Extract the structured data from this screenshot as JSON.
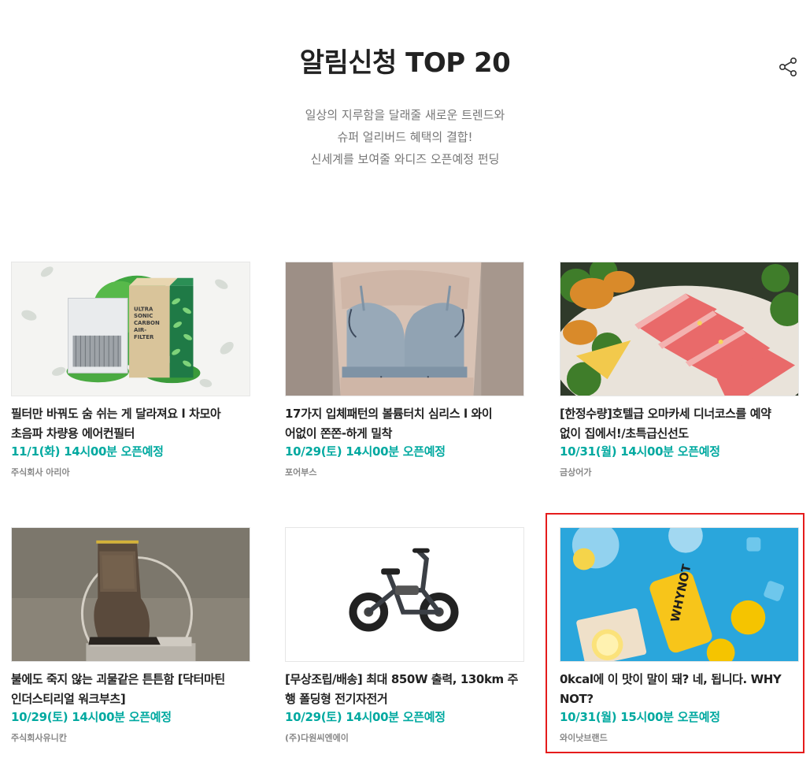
{
  "header": {
    "title": "알림신청 TOP 20",
    "subtitle_lines": [
      "일상의 지루함을 달래줄 새로운 트렌드와",
      "슈퍼 얼리버드 혜택의 결합!",
      "신세계를 보여줄 와디즈 오픈예정 펀딩"
    ],
    "share_icon": "share-icon"
  },
  "cards": [
    {
      "title_lines": [
        "필터만 바꿔도 숨 쉬는 게 달라져요 l 차모아",
        "초음파 차량용 에어컨필터"
      ],
      "open": "11/1(화) 14시00분 오픈예정",
      "maker": "주식회사 아리아",
      "image": "car-air-filter-product",
      "product_text": [
        "ULTRA",
        "SONIC",
        "CARBON",
        "AIR-",
        "FILTER"
      ]
    },
    {
      "title_lines": [
        "17가지 입체패턴의 볼륨터치 심리스 l 와이",
        "어없이 쫀쫀-하게 밀착"
      ],
      "open": "10/29(토) 14시00분 오픈예정",
      "maker": "포어부스",
      "image": "seamless-bra"
    },
    {
      "title_lines": [
        "[한정수량]호텔급 오마카세 디너코스를 예약",
        "없이 집에서!/초특급신선도"
      ],
      "open": "10/31(월) 14시00분 오픈예정",
      "maker": "금상어가",
      "image": "sashimi-platter"
    },
    {
      "title_lines": [
        "불에도 죽지 않는 괴물같은 튼튼함 [닥터마틴",
        "인더스티리얼 워크부츠]"
      ],
      "open": "10/29(토) 14시00분 오픈예정",
      "maker": "주식회사유니칸",
      "image": "work-boot"
    },
    {
      "title_lines": [
        "[무상조립/배송] 최대 850W 출력, 130km 주",
        "행 폴딩형 전기자전거"
      ],
      "open": "10/29(토) 14시00분 오픈예정",
      "maker": "(주)다원씨엔에이",
      "image": "folding-ebike"
    },
    {
      "title_lines": [
        "0kcal에 이 맛이 말이 돼? 네, 됩니다. WHY",
        "NOT?"
      ],
      "open": "10/31(월) 15시00분 오픈예정",
      "maker": "와이낫브랜드",
      "image": "lemon-soda-can",
      "product_text": [
        "WHYNOT"
      ]
    }
  ],
  "colors": {
    "accent": "#00a9a0",
    "highlight_border": "#e51c1c",
    "title": "#222222",
    "muted": "#777777"
  }
}
